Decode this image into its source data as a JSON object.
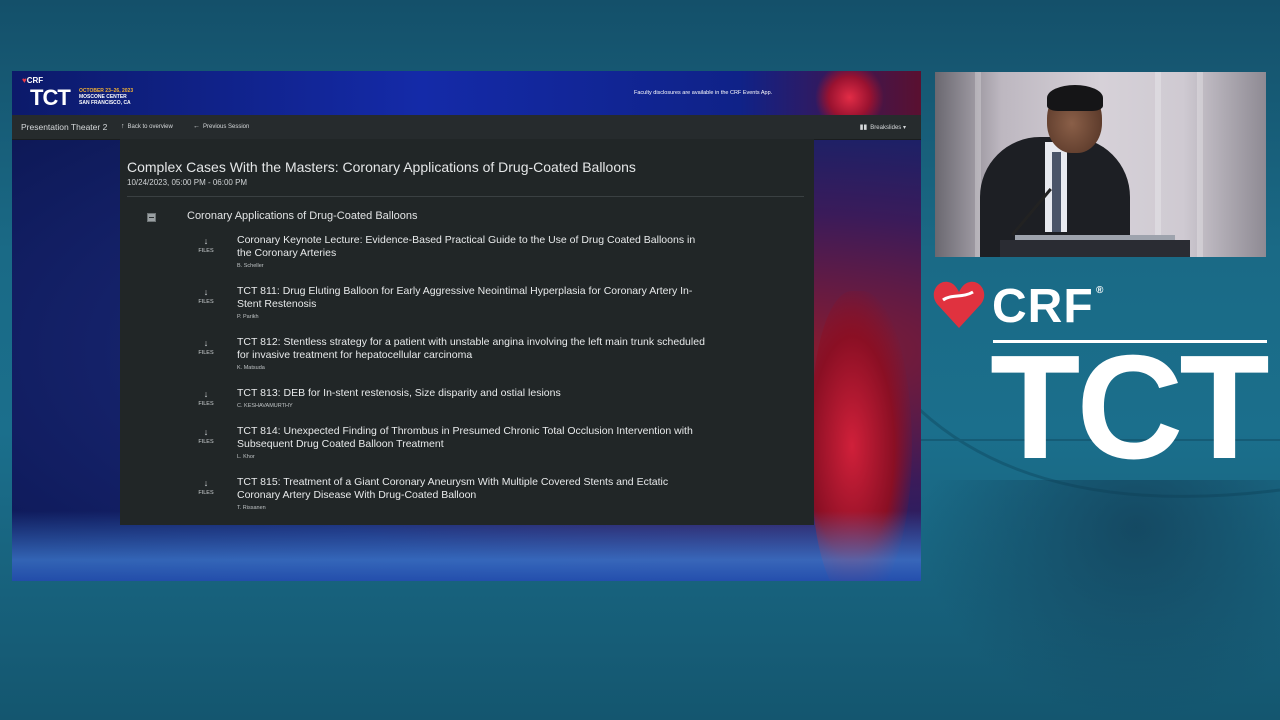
{
  "conference": {
    "crf_label": "CRF",
    "tct_label": "TCT",
    "dates": "OCTOBER 23–26, 2023",
    "venue": "MOSCONE CENTER",
    "city": "SAN FRANCISCO, CA",
    "disclosure_note": "Faculty disclosures are available in the CRF Events App."
  },
  "nav": {
    "room": "Presentation Theater 2",
    "back_label": "Back to overview",
    "prev_label": "Previous Session",
    "breakslides_label": "Breakslides"
  },
  "session": {
    "title": "Complex Cases With the Masters: Coronary Applications of Drug-Coated Balloons",
    "time": "10/24/2023, 05:00 PM - 06:00 PM",
    "group_title": "Coronary Applications of Drug-Coated Balloons",
    "files_label": "FILES",
    "presentations": [
      {
        "title": "Coronary Keynote Lecture: Evidence-Based Practical Guide to the Use of Drug Coated Balloons in the Coronary Arteries",
        "author": "B. Scheller"
      },
      {
        "title": "TCT 811: Drug Eluting Balloon for Early Aggressive Neointimal Hyperplasia for Coronary Artery In-Stent Restenosis",
        "author": "P. Parikh"
      },
      {
        "title": "TCT 812: Stentless strategy for a patient with unstable angina involving the left main trunk scheduled for invasive treatment for hepatocellular carcinoma",
        "author": "K. Matsuda"
      },
      {
        "title": "TCT 813: DEB for In-stent restenosis, Size disparity and ostial lesions",
        "author": "C. KESHAVAMURTHY"
      },
      {
        "title": "TCT 814: Unexpected Finding of Thrombus in Presumed Chronic Total Occlusion Intervention with Subsequent Drug Coated Balloon Treatment",
        "author": "L. Khor"
      },
      {
        "title": "TCT 815: Treatment of a Giant Coronary Aneurysm With Multiple Covered Stents and Ectatic Coronary Artery Disease With Drug-Coated Balloon",
        "author": "T. Rissanen"
      }
    ]
  },
  "brand": {
    "crf": "CRF",
    "reg": "®",
    "tct": "TCT"
  },
  "colors": {
    "crf_red": "#e0323f",
    "date_gold": "#f3b234",
    "panel_bg": "#212627",
    "nav_bg": "#262b2d"
  }
}
